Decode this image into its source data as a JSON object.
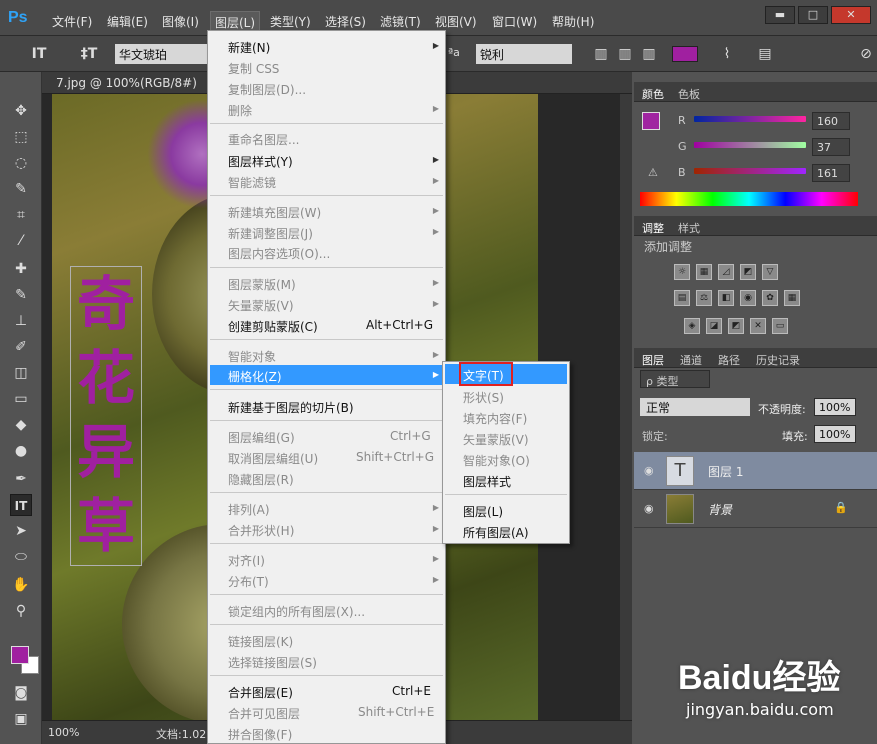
{
  "app": {
    "logo": "Ps"
  },
  "menubar": [
    {
      "label": "文件(F)"
    },
    {
      "label": "编辑(E)"
    },
    {
      "label": "图像(I)"
    },
    {
      "label": "图层(L)"
    },
    {
      "label": "类型(Y)"
    },
    {
      "label": "选择(S)"
    },
    {
      "label": "滤镜(T)"
    },
    {
      "label": "视图(V)"
    },
    {
      "label": "窗口(W)"
    },
    {
      "label": "帮助(H)"
    }
  ],
  "window_buttons": {
    "minimize": "▬",
    "restore": "□",
    "close": "✕"
  },
  "options": {
    "font": "华文琥珀",
    "aa_label": "ªa",
    "antialias": "锐利",
    "text_color": "#a020a0"
  },
  "document": {
    "tab_title": "7.jpg @ 100%(RGB/8#)",
    "text_chars": [
      "奇",
      "花",
      "异",
      "草"
    ],
    "text_color": "#a020a0"
  },
  "status": {
    "zoom": "100%",
    "doc": "文档:1.02"
  },
  "layer_menu": {
    "items": [
      {
        "label": "新建(N)",
        "disabled": false,
        "submenu": true
      },
      {
        "label": "复制 CSS",
        "disabled": true
      },
      {
        "label": "复制图层(D)...",
        "disabled": true
      },
      {
        "label": "删除",
        "disabled": true,
        "submenu": true
      },
      {
        "label": "重命名图层...",
        "disabled": true
      },
      {
        "label": "图层样式(Y)",
        "disabled": false,
        "submenu": true
      },
      {
        "label": "智能滤镜",
        "disabled": true,
        "submenu": true
      },
      {
        "label": "新建填充图层(W)",
        "disabled": true,
        "submenu": true
      },
      {
        "label": "新建调整图层(J)",
        "disabled": true,
        "submenu": true
      },
      {
        "label": "图层内容选项(O)...",
        "disabled": true
      },
      {
        "label": "图层蒙版(M)",
        "disabled": true,
        "submenu": true
      },
      {
        "label": "矢量蒙版(V)",
        "disabled": true,
        "submenu": true
      },
      {
        "label": "创建剪贴蒙版(C)",
        "disabled": false,
        "shortcut": "Alt+Ctrl+G"
      },
      {
        "label": "智能对象",
        "disabled": true,
        "submenu": true
      },
      {
        "label": "栅格化(Z)",
        "disabled": false,
        "submenu": true,
        "highlighted": true
      },
      {
        "label": "新建基于图层的切片(B)",
        "disabled": false
      },
      {
        "label": "图层编组(G)",
        "disabled": true,
        "shortcut": "Ctrl+G"
      },
      {
        "label": "取消图层编组(U)",
        "disabled": true,
        "shortcut": "Shift+Ctrl+G"
      },
      {
        "label": "隐藏图层(R)",
        "disabled": true
      },
      {
        "label": "排列(A)",
        "disabled": true,
        "submenu": true
      },
      {
        "label": "合并形状(H)",
        "disabled": true,
        "submenu": true
      },
      {
        "label": "对齐(I)",
        "disabled": true,
        "submenu": true
      },
      {
        "label": "分布(T)",
        "disabled": true,
        "submenu": true
      },
      {
        "label": "锁定组内的所有图层(X)...",
        "disabled": true
      },
      {
        "label": "链接图层(K)",
        "disabled": true
      },
      {
        "label": "选择链接图层(S)",
        "disabled": true
      },
      {
        "label": "合并图层(E)",
        "disabled": false,
        "shortcut": "Ctrl+E"
      },
      {
        "label": "合并可见图层",
        "disabled": true,
        "shortcut": "Shift+Ctrl+E"
      },
      {
        "label": "拼合图像(F)",
        "disabled": true
      }
    ]
  },
  "rasterize_submenu": {
    "items": [
      {
        "label": "文字(T)",
        "disabled": false,
        "highlighted": true
      },
      {
        "label": "形状(S)",
        "disabled": true
      },
      {
        "label": "填充内容(F)",
        "disabled": true
      },
      {
        "label": "矢量蒙版(V)",
        "disabled": true
      },
      {
        "label": "智能对象(O)",
        "disabled": true
      },
      {
        "label": "图层样式",
        "disabled": false
      },
      {
        "label": "图层(L)",
        "disabled": false
      },
      {
        "label": "所有图层(A)",
        "disabled": false
      }
    ]
  },
  "color_panel": {
    "tabs": [
      "颜色",
      "色板"
    ],
    "r_label": "R",
    "g_label": "G",
    "b_label": "B",
    "r": "160",
    "g": "37",
    "b": "161",
    "fg_color": "#a025a1"
  },
  "adjust_panel": {
    "tabs": [
      "调整",
      "样式"
    ],
    "title": "添加调整"
  },
  "layers_panel": {
    "tabs": [
      "图层",
      "通道",
      "路径",
      "历史记录"
    ],
    "filter": "ρ 类型",
    "blend": "正常",
    "opacity_label": "不透明度:",
    "opacity": "100%",
    "lock_label": "锁定:",
    "fill_label": "填充:",
    "fill": "100%",
    "layers": [
      {
        "name": "图层 1",
        "type": "text",
        "selected": true
      },
      {
        "name": "背景",
        "type": "image",
        "selected": false
      }
    ]
  },
  "watermark": {
    "logo": "Baidu经验",
    "url": "jingyan.baidu.com"
  }
}
